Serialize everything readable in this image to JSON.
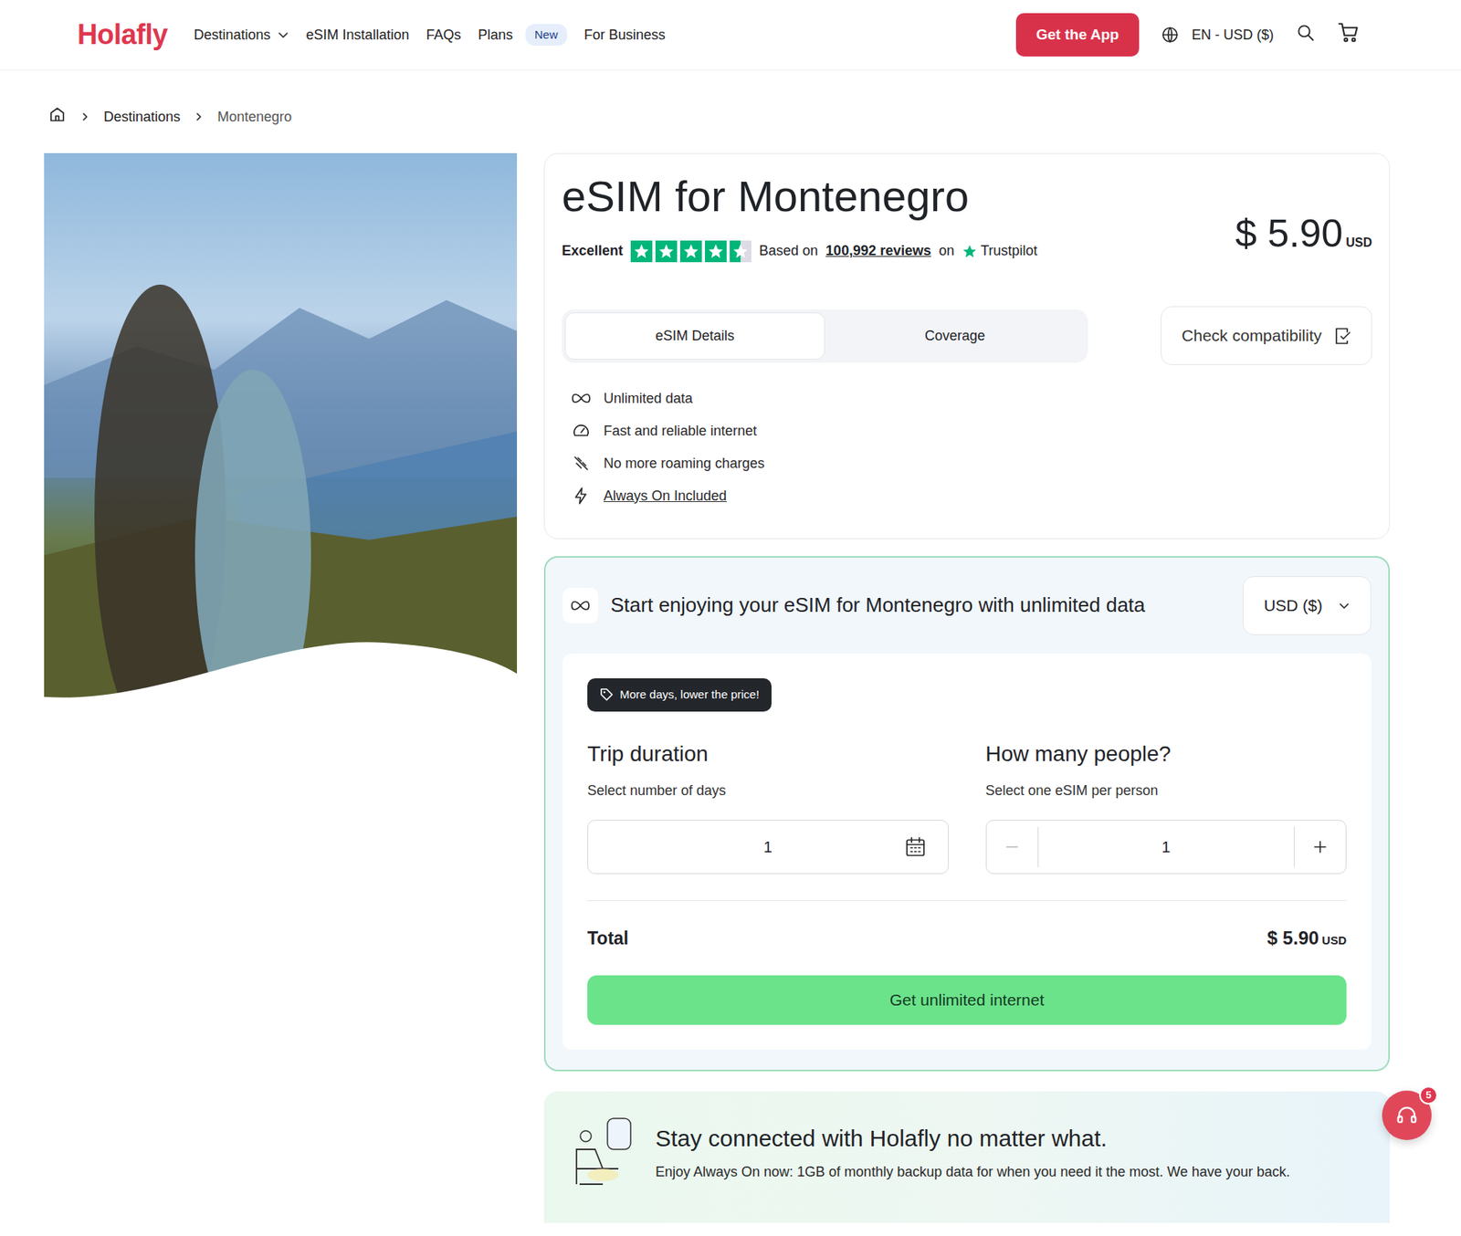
{
  "header": {
    "logo": "Holafly",
    "nav": [
      {
        "label": "Destinations",
        "kind": "dropdown"
      },
      {
        "label": "eSIM Installation",
        "kind": "link"
      },
      {
        "label": "FAQs",
        "kind": "link"
      },
      {
        "label": "Plans",
        "kind": "badge",
        "badge": "New"
      },
      {
        "label": "For Business",
        "kind": "link"
      }
    ],
    "app_button": "Get the App",
    "locale": "EN - USD ($)"
  },
  "breadcrumb": [
    "Destinations",
    "Montenegro"
  ],
  "product": {
    "title": "eSIM for Montenegro",
    "price": "$ 5.90",
    "currency": "USD",
    "rating": {
      "label": "Excellent",
      "stars": 4.5,
      "based_on": "Based on",
      "reviews": "100,992 reviews",
      "on": "on",
      "source": "Trustpilot"
    },
    "tabs": [
      {
        "label": "eSIM Details",
        "selected": true
      },
      {
        "label": "Coverage",
        "selected": false
      }
    ],
    "compat_button": "Check compatibility",
    "features": [
      {
        "label": "Unlimited data",
        "kind": "infinity",
        "link": false
      },
      {
        "label": "Fast and reliable internet",
        "kind": "speed",
        "link": false
      },
      {
        "label": "No more roaming charges",
        "kind": "noroaming",
        "link": false
      },
      {
        "label": "Always On Included",
        "kind": "bolt",
        "link": true
      }
    ]
  },
  "purchase": {
    "title": "Start enjoying your eSIM for Montenegro with unlimited data",
    "currency_select": "USD ($)",
    "tag": "More days, lower the price!",
    "duration": {
      "title": "Trip duration",
      "hint": "Select number of days",
      "value": "1"
    },
    "people": {
      "title": "How many people?",
      "hint": "Select one eSIM per person",
      "value": "1",
      "minus_disabled": true
    },
    "total_label": "Total",
    "total": "$ 5.90",
    "total_currency": "USD",
    "cta": "Get unlimited internet"
  },
  "promo": {
    "title": "Stay connected with Holafly no matter what.",
    "text": "Enjoy Always On now: 1GB of monthly backup data for when you need it the most. We have your back."
  },
  "chat": {
    "badge": "5"
  }
}
